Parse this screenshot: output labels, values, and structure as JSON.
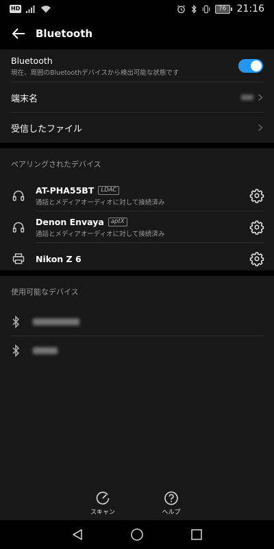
{
  "status_bar": {
    "hd_badge": "HD",
    "battery_level": "76",
    "time": "21:16"
  },
  "app_bar": {
    "title": "Bluetooth"
  },
  "bluetooth_toggle": {
    "title": "Bluetooth",
    "subtitle": "現在、周囲のBluetoothデバイスから検出可能な状態です",
    "enabled": true,
    "accent_color": "#2196f3"
  },
  "settings_rows": {
    "device_name_label": "端末名",
    "received_files_label": "受信したファイル"
  },
  "paired": {
    "header": "ペアリングされたデバイス",
    "devices": [
      {
        "name": "AT-PHA55BT",
        "codec": "LDAC",
        "status": "通話とメディアオーディオに対して接続済み",
        "icon": "headphones-icon"
      },
      {
        "name": "Denon Envaya",
        "codec": "aptX",
        "status": "通話とメディアオーディオに対して接続済み",
        "icon": "headphones-icon"
      },
      {
        "name": "Nikon Z 6",
        "codec": "",
        "status": "",
        "icon": "printer-icon"
      }
    ]
  },
  "available": {
    "header": "使用可能なデバイス"
  },
  "actions": {
    "scan_label": "スキャン",
    "help_label": "ヘルプ"
  }
}
